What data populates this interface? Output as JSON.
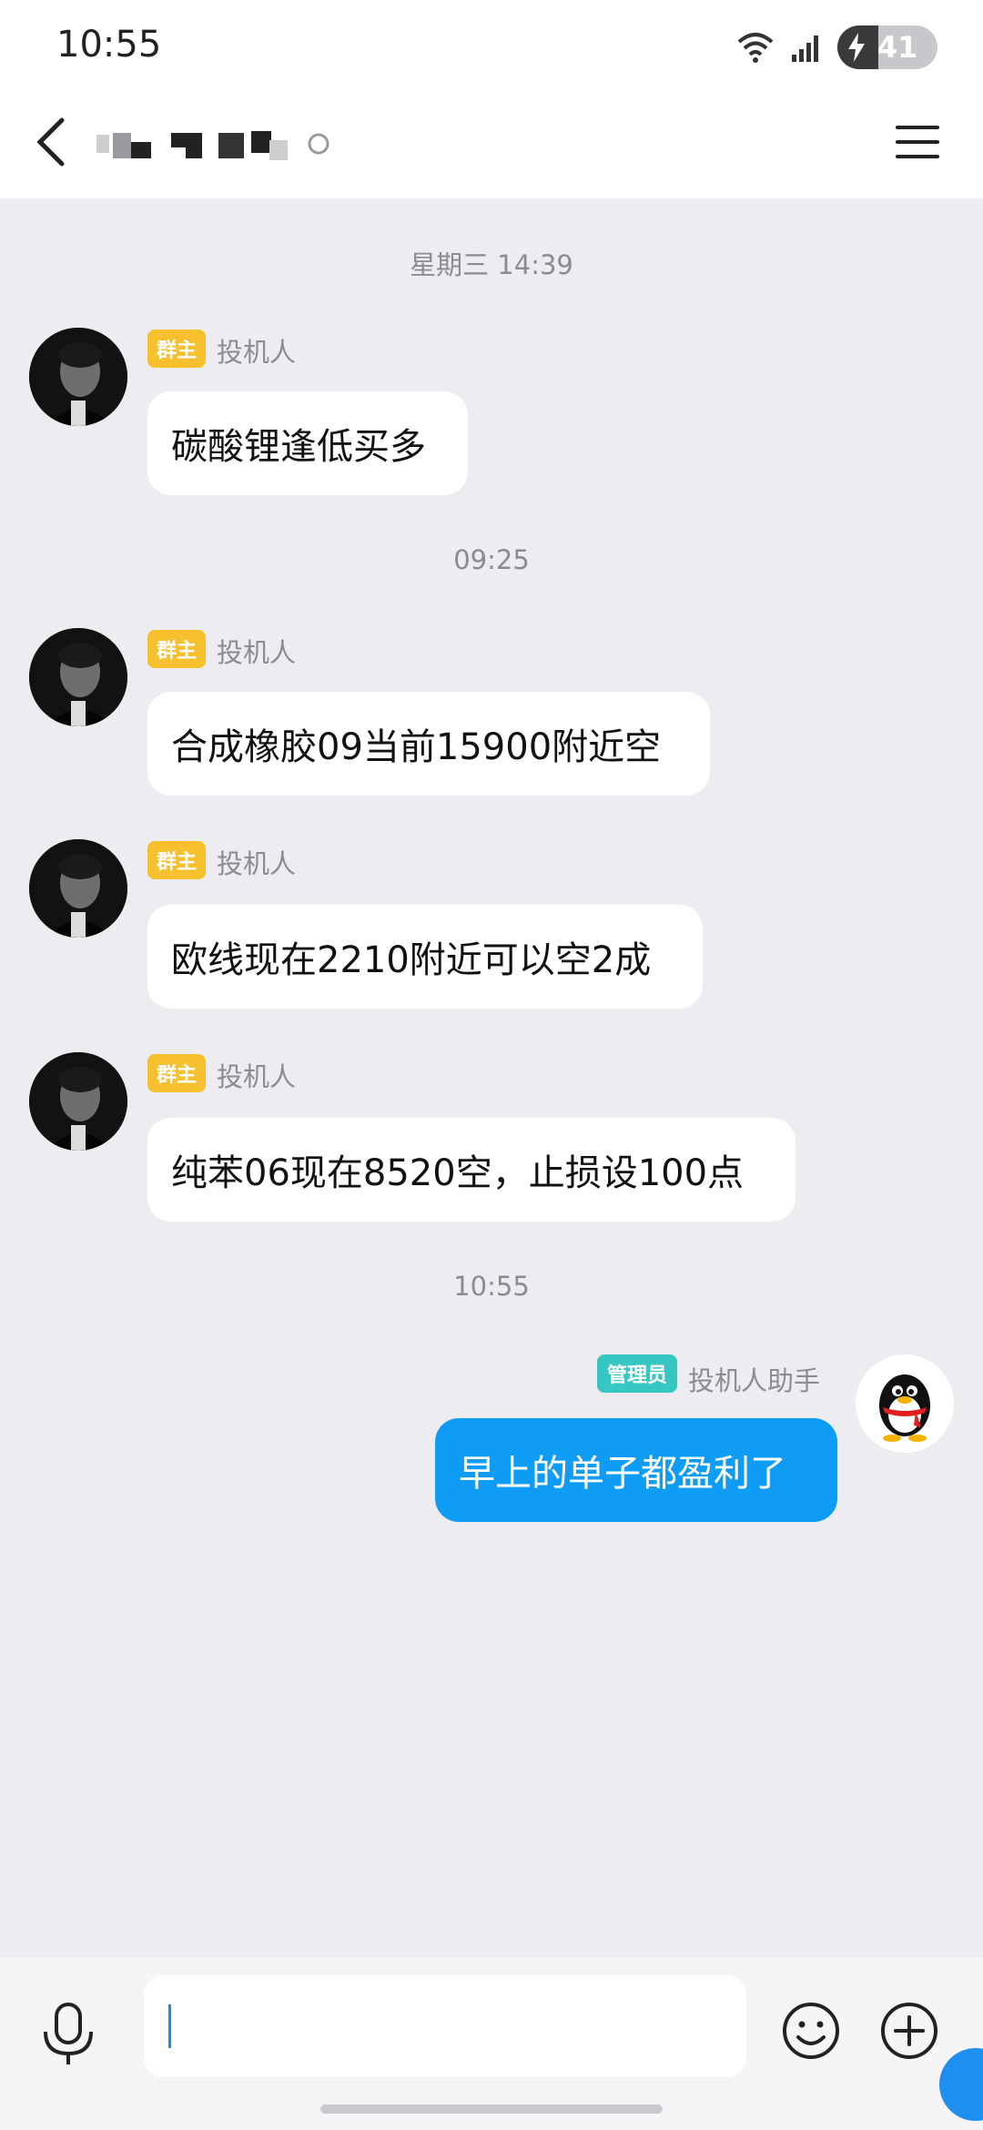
{
  "status_bar": {
    "time": "10:55",
    "battery_level": "41",
    "battery_percent": 0.41
  },
  "header": {
    "chat_title": "",
    "back_icon": "back-icon",
    "menu_icon": "menu-icon"
  },
  "messages": [
    {
      "type": "timestamp",
      "text": "星期三 14:39"
    },
    {
      "type": "incoming",
      "badge": "群主",
      "sender": "投机人",
      "text": "碳酸锂逢低买多"
    },
    {
      "type": "timestamp",
      "text": "09:25"
    },
    {
      "type": "incoming",
      "badge": "群主",
      "sender": "投机人",
      "text": "合成橡胶09当前15900附近空"
    },
    {
      "type": "incoming",
      "badge": "群主",
      "sender": "投机人",
      "text": "欧线现在2210附近可以空2成"
    },
    {
      "type": "incoming",
      "badge": "群主",
      "sender": "投机人",
      "text": "纯苯06现在8520空，止损设100点"
    },
    {
      "type": "timestamp",
      "text": "10:55"
    },
    {
      "type": "outgoing",
      "badge": "管理员",
      "sender": "投机人助手",
      "text": "早上的单子都盈利了"
    }
  ],
  "input_bar": {
    "input_value": "",
    "icons": [
      "microphone-icon",
      "emoji-icon",
      "plus-icon"
    ]
  },
  "colors": {
    "background": "#ededf1",
    "bubble_in": "#ffffff",
    "bubble_out": "#0f9cf5",
    "badge_owner": "#f6c02e",
    "badge_admin": "#36c7c2",
    "meta_text": "#8b8b90"
  }
}
